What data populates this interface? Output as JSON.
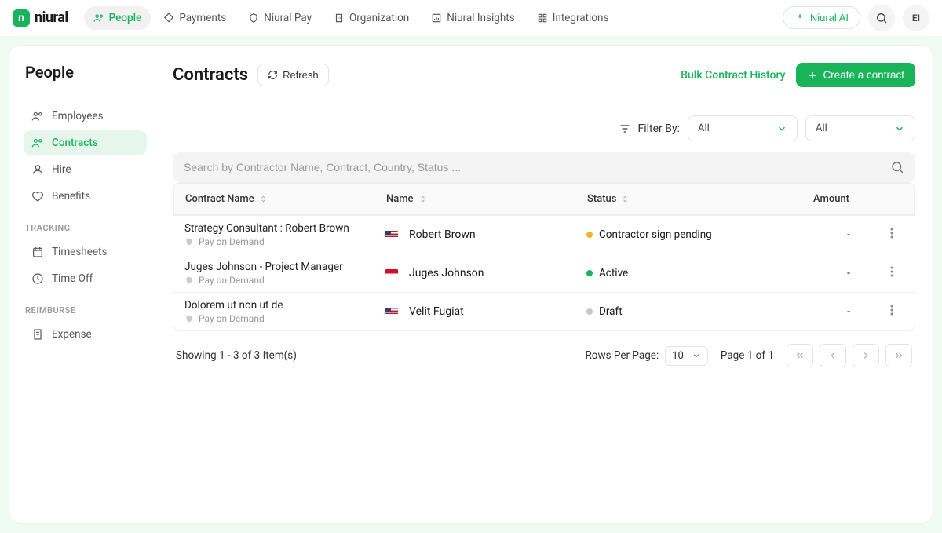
{
  "brand": {
    "name": "niural"
  },
  "topnav": [
    {
      "label": "People",
      "active": true
    },
    {
      "label": "Payments"
    },
    {
      "label": "Niural Pay"
    },
    {
      "label": "Organization"
    },
    {
      "label": "Niural Insights"
    },
    {
      "label": "Integrations"
    }
  ],
  "ai_button": "Niural AI",
  "avatar": "EI",
  "sidebar": {
    "title": "People",
    "main": [
      {
        "label": "Employees"
      },
      {
        "label": "Contracts",
        "active": true
      },
      {
        "label": "Hire"
      },
      {
        "label": "Benefits"
      }
    ],
    "tracking_label": "TRACKING",
    "tracking": [
      {
        "label": "Timesheets"
      },
      {
        "label": "Time Off"
      }
    ],
    "reimburse_label": "REIMBURSE",
    "reimburse": [
      {
        "label": "Expense"
      }
    ]
  },
  "page": {
    "title": "Contracts",
    "refresh": "Refresh",
    "bulk_history": "Bulk Contract History",
    "create_btn": "Create a contract"
  },
  "filter": {
    "label": "Filter By:",
    "select1": "All",
    "select2": "All"
  },
  "search": {
    "placeholder": "Search by Contractor Name, Contract, Country, Status ..."
  },
  "columns": {
    "contract": "Contract Name",
    "name": "Name",
    "status": "Status",
    "amount": "Amount"
  },
  "rows": [
    {
      "contract": "Strategy Consultant : Robert Brown",
      "sub": "Pay on Demand",
      "flag": "us",
      "name": "Robert Brown",
      "status": "Contractor sign pending",
      "status_color": "#f0b429",
      "amount": "-"
    },
    {
      "contract": "Juges Johnson - Project Manager",
      "sub": "Pay on Demand",
      "flag": "id",
      "name": "Juges Johnson",
      "status": "Active",
      "status_color": "#19b35a",
      "amount": "-"
    },
    {
      "contract": "Dolorem ut non ut de",
      "sub": "Pay on Demand",
      "flag": "us",
      "name": "Velit Fugiat",
      "status": "Draft",
      "status_color": "#c8c8c8",
      "amount": "-"
    }
  ],
  "footer": {
    "showing": "Showing 1 - 3 of 3 Item(s)",
    "rpp_label": "Rows Per Page:",
    "rpp_value": "10",
    "page_of": "Page 1 of 1"
  }
}
